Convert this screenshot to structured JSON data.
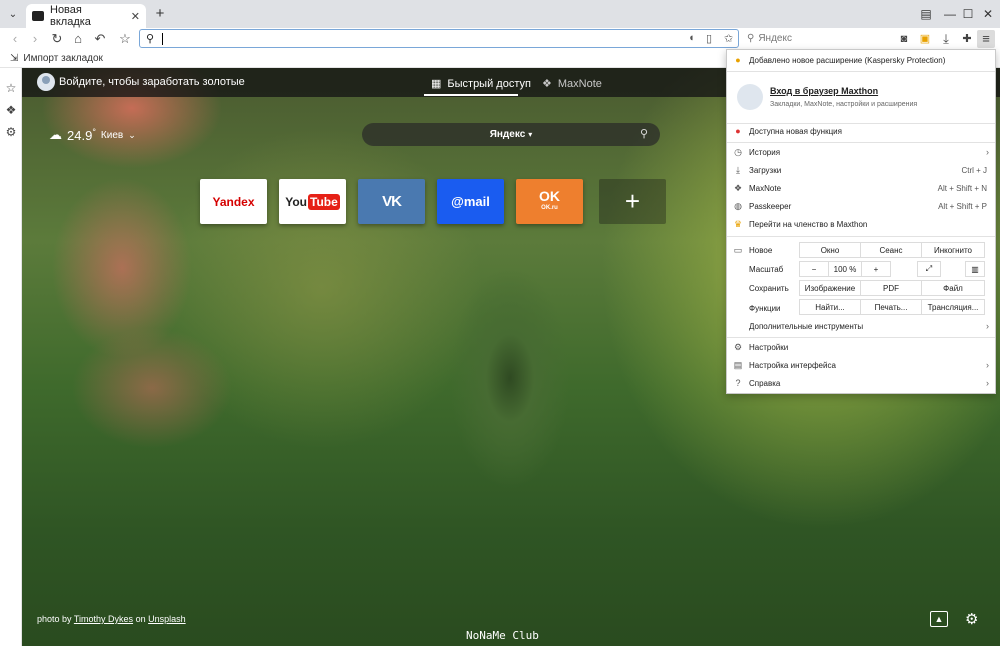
{
  "tabstrip": {
    "tab_title": "Новая вкладка",
    "new_tab": "+",
    "minimize": "—",
    "maximize": "☐",
    "close": "✕"
  },
  "toolbar": {
    "web_search_placeholder": "Яндекс"
  },
  "bookmarks_bar": {
    "import_label": "Импорт закладок"
  },
  "page": {
    "signin_text": "Войдите, чтобы заработать золотые",
    "tabs": [
      {
        "label": "Быстрый доступ"
      },
      {
        "label": "MaxNote"
      }
    ],
    "weather": {
      "temp": "24.9",
      "unit": "°",
      "city": "Киев"
    },
    "search_engine": "Яндекс",
    "tiles": [
      {
        "label": "Yandex",
        "color": "#ffffff"
      },
      {
        "label": "You",
        "label2": "Tube",
        "color": "#ffffff"
      },
      {
        "label": "VK",
        "color": "#4a79b0"
      },
      {
        "label": "@mail",
        "color": "#1a5cf0"
      },
      {
        "label": "OK",
        "sub": "OK.ru",
        "color": "#ee7f2e"
      },
      {
        "label": "+",
        "color": "#333333"
      }
    ],
    "credit": {
      "prefix": "photo by",
      "author": "Timothy Dykes",
      "on": "on",
      "site": "Unsplash"
    },
    "watermark": "NoNaMe Club"
  },
  "menu": {
    "notice": "Добавлено новое расширение (Kaspersky Protection)",
    "account_title": "Вход в браузер Maxthon",
    "account_sub": "Закладки, MaxNote, настройки и расширения",
    "new_feature": "Доступна новая функция",
    "items": [
      {
        "label": "История",
        "shortcut": "",
        "arrow": "›"
      },
      {
        "label": "Загрузки",
        "shortcut": "Ctrl + J",
        "arrow": ""
      },
      {
        "label": "MaxNote",
        "shortcut": "Alt + Shift + N",
        "arrow": ""
      },
      {
        "label": "Passkeeper",
        "shortcut": "Alt + Shift + P",
        "arrow": ""
      },
      {
        "label": "Перейти на членство в Maxthon",
        "shortcut": "",
        "arrow": ""
      }
    ],
    "new_label": "Новое",
    "new_options": [
      "Окно",
      "Сеанс",
      "Инкогнито"
    ],
    "zoom_label": "Масштаб",
    "zoom_minus": "−",
    "zoom_value": "100 %",
    "zoom_plus": "+",
    "save_label": "Сохранить",
    "save_options": [
      "Изображение",
      "PDF",
      "Файл"
    ],
    "functions_label": "Функции",
    "function_options": [
      "Найти...",
      "Печать...",
      "Трансляция..."
    ],
    "more_tools": "Дополнительные инструменты",
    "settings": "Настройки",
    "ui_settings": "Настройка интерфейса",
    "help": "Справка",
    "arrow": "›"
  }
}
